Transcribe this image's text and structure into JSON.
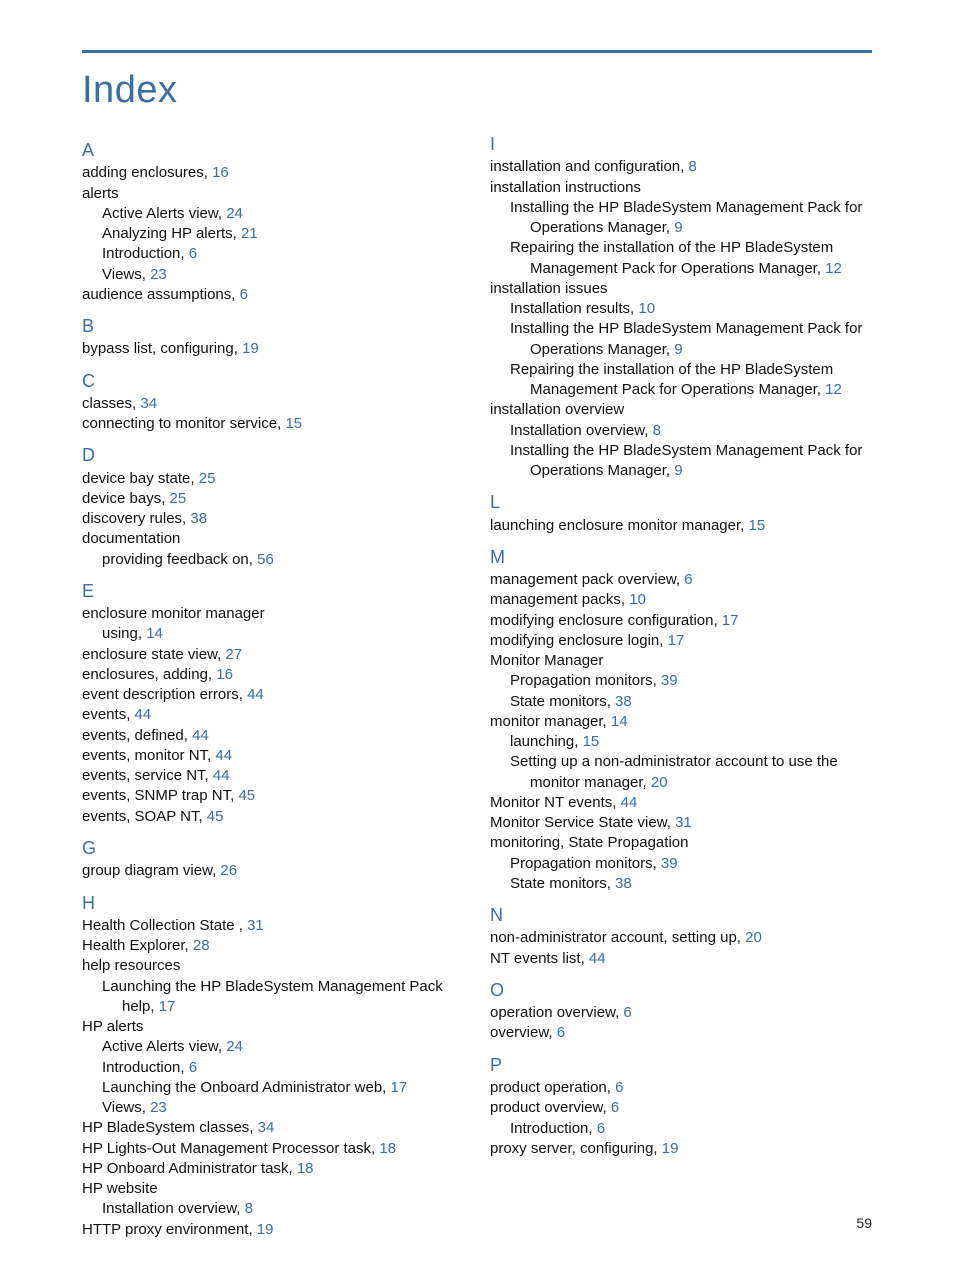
{
  "title": "Index",
  "page_number": "59",
  "sections": [
    {
      "letter": "A",
      "entries": [
        {
          "text": "adding enclosures, ",
          "page": "16"
        },
        {
          "text": "alerts"
        },
        {
          "text": "Active Alerts view, ",
          "page": "24",
          "sub": true
        },
        {
          "text": "Analyzing HP alerts, ",
          "page": "21",
          "sub": true
        },
        {
          "text": "Introduction, ",
          "page": "6",
          "sub": true
        },
        {
          "text": "Views, ",
          "page": "23",
          "sub": true
        },
        {
          "text": "audience assumptions, ",
          "page": "6"
        }
      ]
    },
    {
      "letter": "B",
      "entries": [
        {
          "text": "bypass list, configuring, ",
          "page": "19"
        }
      ]
    },
    {
      "letter": "C",
      "entries": [
        {
          "text": "classes, ",
          "page": "34"
        },
        {
          "text": "connecting to monitor service, ",
          "page": "15"
        }
      ]
    },
    {
      "letter": "D",
      "entries": [
        {
          "text": "device bay state, ",
          "page": "25"
        },
        {
          "text": "device bays, ",
          "page": "25"
        },
        {
          "text": "discovery rules, ",
          "page": "38"
        },
        {
          "text": "documentation"
        },
        {
          "text": "providing feedback on, ",
          "page": "56",
          "sub": true
        }
      ]
    },
    {
      "letter": "E",
      "entries": [
        {
          "text": "enclosure monitor manager"
        },
        {
          "text": "using, ",
          "page": "14",
          "sub": true
        },
        {
          "text": "enclosure state view, ",
          "page": "27"
        },
        {
          "text": "enclosures, adding, ",
          "page": "16"
        },
        {
          "text": "event description errors, ",
          "page": "44"
        },
        {
          "text": "events, ",
          "page": "44"
        },
        {
          "text": "events, defined, ",
          "page": "44"
        },
        {
          "text": "events, monitor NT, ",
          "page": "44"
        },
        {
          "text": "events, service NT, ",
          "page": "44"
        },
        {
          "text": "events, SNMP trap NT, ",
          "page": "45"
        },
        {
          "text": "events, SOAP NT, ",
          "page": "45"
        }
      ]
    },
    {
      "letter": "G",
      "entries": [
        {
          "text": "group diagram view, ",
          "page": "26"
        }
      ]
    },
    {
      "letter": "H",
      "entries": [
        {
          "text": "Health Collection State , ",
          "page": "31"
        },
        {
          "text": "Health Explorer, ",
          "page": "28"
        },
        {
          "text": "help resources"
        },
        {
          "text": "Launching the HP BladeSystem Management Pack help, ",
          "page": "17",
          "sub": true
        },
        {
          "text": "HP alerts"
        },
        {
          "text": "Active Alerts view, ",
          "page": "24",
          "sub": true
        },
        {
          "text": "Introduction, ",
          "page": "6",
          "sub": true
        },
        {
          "text": "Launching the Onboard Administrator web, ",
          "page": "17",
          "sub": true
        },
        {
          "text": "Views, ",
          "page": "23",
          "sub": true
        },
        {
          "text": "HP BladeSystem classes, ",
          "page": "34"
        },
        {
          "text": "HP Lights-Out Management Processor task, ",
          "page": "18"
        },
        {
          "text": "HP Onboard Administrator task, ",
          "page": "18"
        },
        {
          "text": "HP website"
        },
        {
          "text": "Installation overview, ",
          "page": "8",
          "sub": true
        },
        {
          "text": "HTTP proxy environment, ",
          "page": "19"
        }
      ]
    },
    {
      "letter": "I",
      "entries": [
        {
          "text": "installation and configuration, ",
          "page": "8"
        },
        {
          "text": "installation instructions"
        },
        {
          "text": "Installing the HP BladeSystem Management Pack for Operations Manager, ",
          "page": "9",
          "sub": true
        },
        {
          "text": "Repairing the installation of the HP BladeSystem Management Pack for Operations Manager, ",
          "page": "12",
          "sub": true
        },
        {
          "text": "installation issues"
        },
        {
          "text": "Installation results, ",
          "page": "10",
          "sub": true
        },
        {
          "text": "Installing the HP BladeSystem Management Pack for Operations Manager, ",
          "page": "9",
          "sub": true
        },
        {
          "text": "Repairing the installation of the HP BladeSystem Management Pack for Operations Manager, ",
          "page": "12",
          "sub": true
        },
        {
          "text": "installation overview"
        },
        {
          "text": "Installation overview, ",
          "page": "8",
          "sub": true
        },
        {
          "text": "Installing the HP BladeSystem Management Pack for Operations Manager, ",
          "page": "9",
          "sub": true
        }
      ]
    },
    {
      "letter": "L",
      "entries": [
        {
          "text": "launching enclosure monitor manager, ",
          "page": "15"
        }
      ]
    },
    {
      "letter": "M",
      "entries": [
        {
          "text": "management pack overview, ",
          "page": "6"
        },
        {
          "text": "management packs, ",
          "page": "10"
        },
        {
          "text": "modifying enclosure configuration, ",
          "page": "17"
        },
        {
          "text": "modifying enclosure login, ",
          "page": "17"
        },
        {
          "text": "Monitor Manager"
        },
        {
          "text": "Propagation monitors, ",
          "page": "39",
          "sub": true
        },
        {
          "text": "State monitors, ",
          "page": "38",
          "sub": true
        },
        {
          "text": "monitor manager, ",
          "page": "14"
        },
        {
          "text": "launching, ",
          "page": "15",
          "sub": true
        },
        {
          "text": "Setting up a non-administrator account to use the monitor manager, ",
          "page": "20",
          "sub": true
        },
        {
          "text": "Monitor NT events, ",
          "page": "44"
        },
        {
          "text": "Monitor Service State view, ",
          "page": "31"
        },
        {
          "text": "monitoring, State Propagation"
        },
        {
          "text": "Propagation monitors, ",
          "page": "39",
          "sub": true
        },
        {
          "text": "State monitors, ",
          "page": "38",
          "sub": true
        }
      ]
    },
    {
      "letter": "N",
      "entries": [
        {
          "text": "non-administrator account, setting up, ",
          "page": "20"
        },
        {
          "text": "NT events list, ",
          "page": "44"
        }
      ]
    },
    {
      "letter": "O",
      "entries": [
        {
          "text": "operation overview, ",
          "page": "6"
        },
        {
          "text": "overview, ",
          "page": "6"
        }
      ]
    },
    {
      "letter": "P",
      "entries": [
        {
          "text": "product operation, ",
          "page": "6"
        },
        {
          "text": "product overview, ",
          "page": "6"
        },
        {
          "text": "Introduction, ",
          "page": "6",
          "sub": true
        },
        {
          "text": "proxy server, configuring, ",
          "page": "19"
        }
      ]
    }
  ]
}
